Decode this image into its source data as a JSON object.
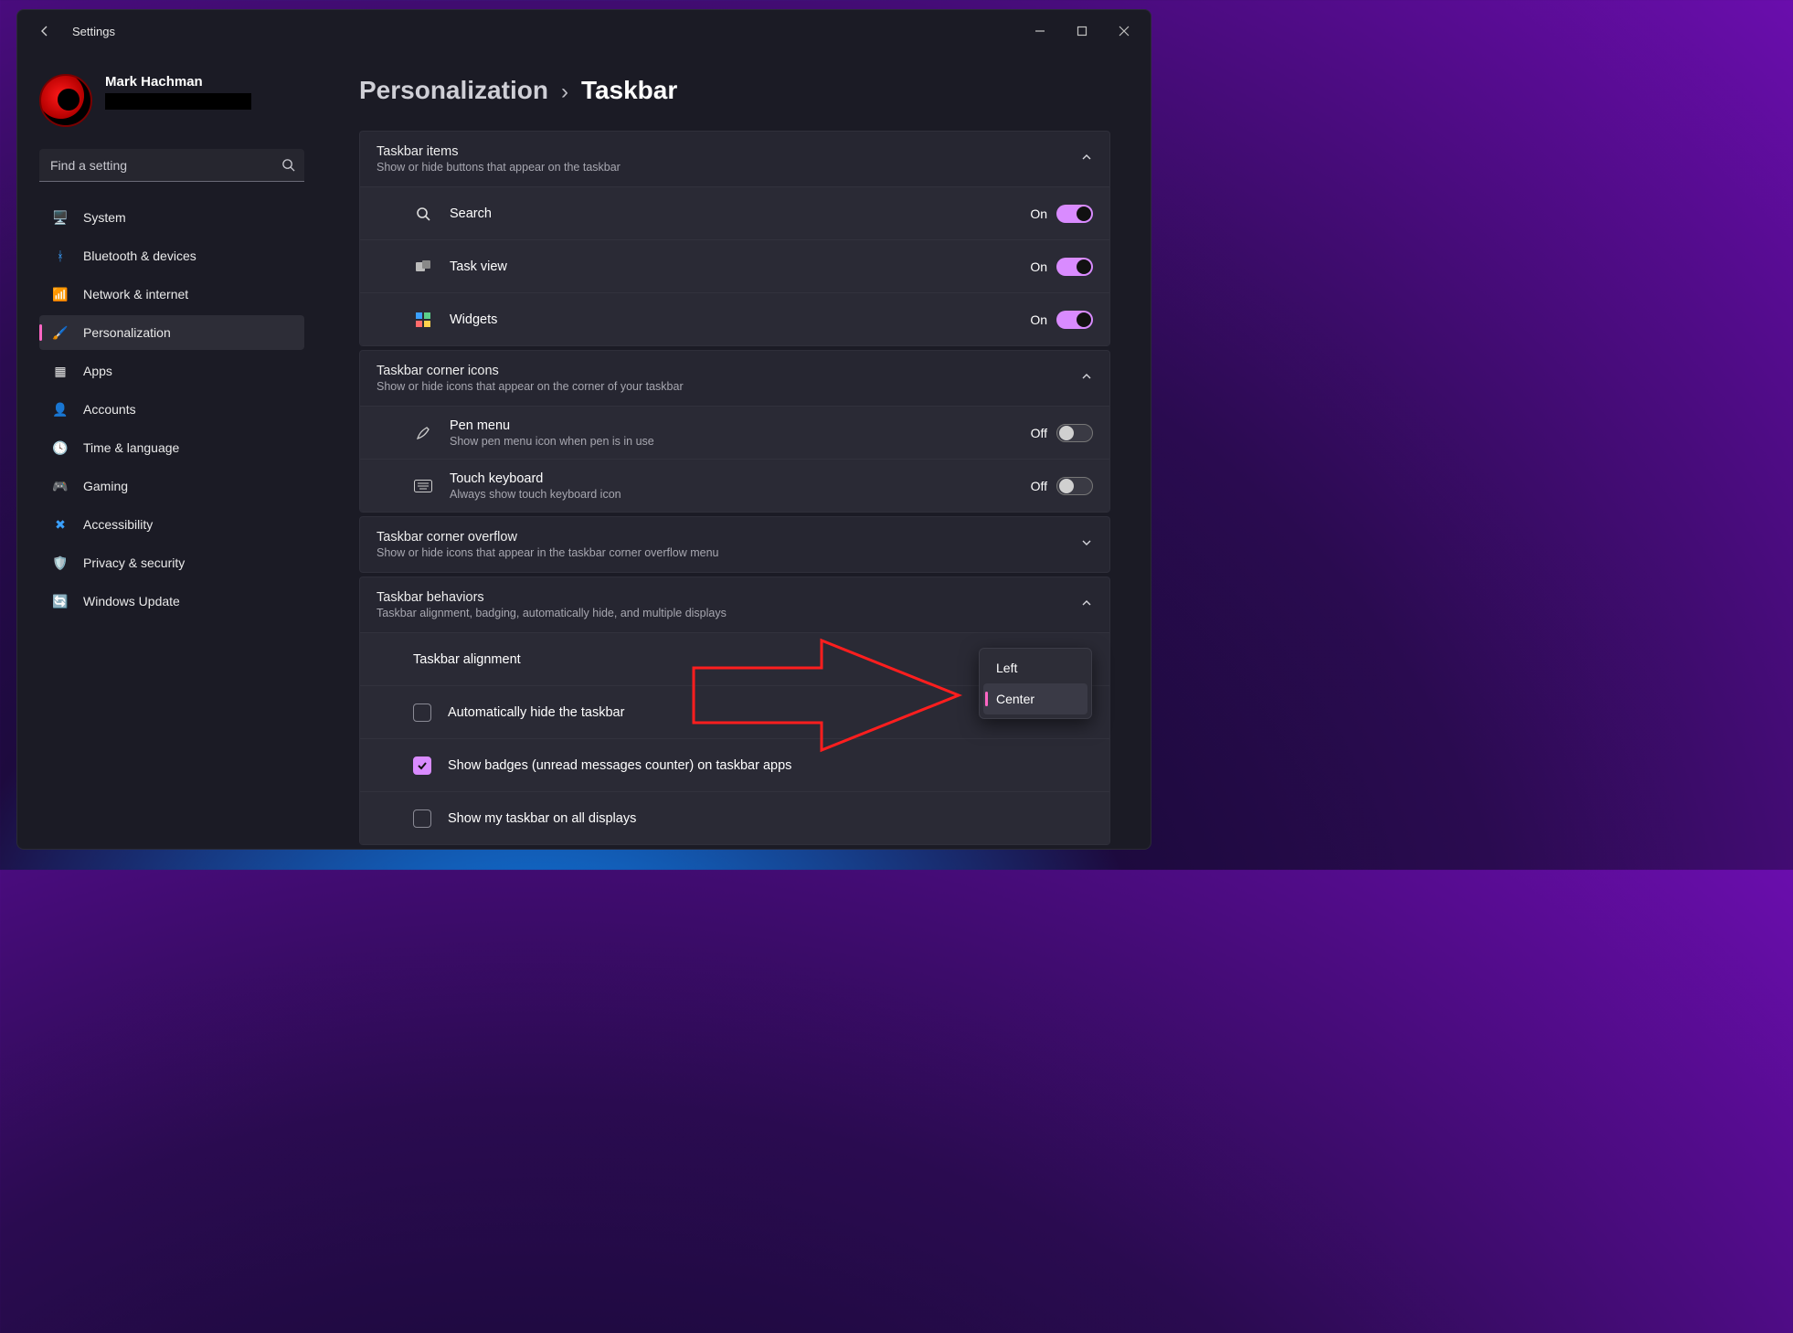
{
  "app": {
    "title": "Settings"
  },
  "account": {
    "name": "Mark Hachman"
  },
  "search": {
    "placeholder": "Find a setting"
  },
  "sidebar": {
    "items": [
      {
        "label": "System"
      },
      {
        "label": "Bluetooth & devices"
      },
      {
        "label": "Network & internet"
      },
      {
        "label": "Personalization"
      },
      {
        "label": "Apps"
      },
      {
        "label": "Accounts"
      },
      {
        "label": "Time & language"
      },
      {
        "label": "Gaming"
      },
      {
        "label": "Accessibility"
      },
      {
        "label": "Privacy & security"
      },
      {
        "label": "Windows Update"
      }
    ],
    "selected_index": 3
  },
  "breadcrumb": {
    "parent": "Personalization",
    "current": "Taskbar"
  },
  "taskbar_items": {
    "header_title": "Taskbar items",
    "header_sub": "Show or hide buttons that appear on the taskbar",
    "rows": [
      {
        "label": "Search",
        "state": "On"
      },
      {
        "label": "Task view",
        "state": "On"
      },
      {
        "label": "Widgets",
        "state": "On"
      }
    ]
  },
  "corner_icons": {
    "header_title": "Taskbar corner icons",
    "header_sub": "Show or hide icons that appear on the corner of your taskbar",
    "rows": [
      {
        "label": "Pen menu",
        "sub": "Show pen menu icon when pen is in use",
        "state": "Off"
      },
      {
        "label": "Touch keyboard",
        "sub": "Always show touch keyboard icon",
        "state": "Off"
      }
    ]
  },
  "corner_overflow": {
    "header_title": "Taskbar corner overflow",
    "header_sub": "Show or hide icons that appear in the taskbar corner overflow menu"
  },
  "behaviors": {
    "header_title": "Taskbar behaviors",
    "header_sub": "Taskbar alignment, badging, automatically hide, and multiple displays",
    "alignment_label": "Taskbar alignment",
    "alignment_options": [
      "Left",
      "Center"
    ],
    "alignment_selected": "Center",
    "checks": [
      {
        "label": "Automatically hide the taskbar",
        "checked": false
      },
      {
        "label": "Show badges (unread messages counter) on taskbar apps",
        "checked": true
      },
      {
        "label": "Show my taskbar on all displays",
        "checked": false
      }
    ]
  }
}
